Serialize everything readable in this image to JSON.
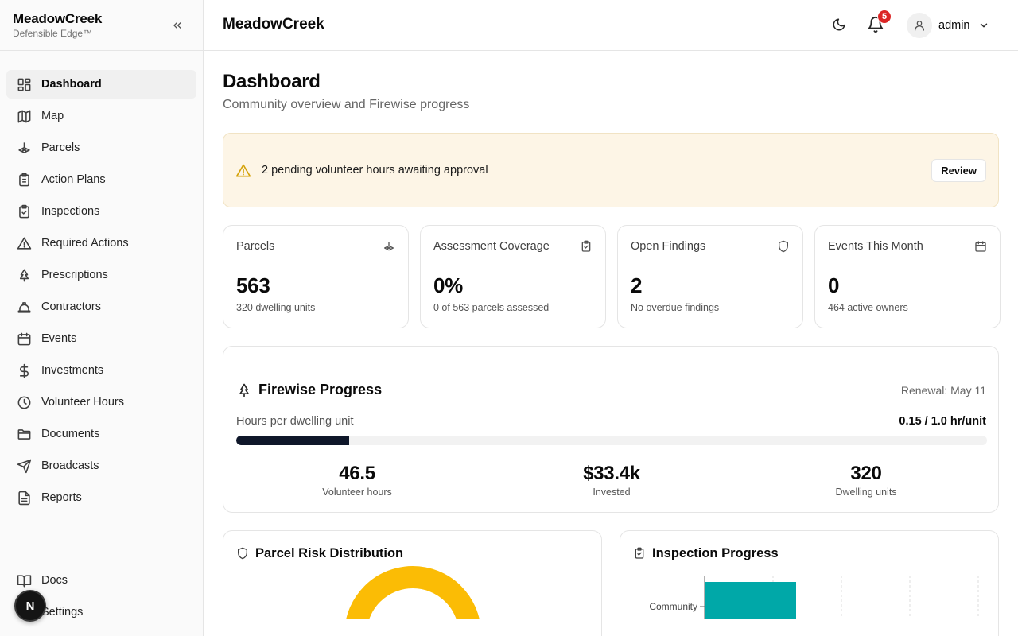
{
  "brand": {
    "name": "MeadowCreek",
    "tagline": "Defensible Edge™"
  },
  "sidebar": {
    "items": [
      {
        "label": "Dashboard",
        "icon": "dashboard-icon",
        "active": true
      },
      {
        "label": "Map",
        "icon": "map-icon"
      },
      {
        "label": "Parcels",
        "icon": "parcels-icon"
      },
      {
        "label": "Action Plans",
        "icon": "clipboard-list-icon"
      },
      {
        "label": "Inspections",
        "icon": "clipboard-check-icon"
      },
      {
        "label": "Required Actions",
        "icon": "warning-icon"
      },
      {
        "label": "Prescriptions",
        "icon": "tree-icon"
      },
      {
        "label": "Contractors",
        "icon": "hard-hat-icon"
      },
      {
        "label": "Events",
        "icon": "calendar-icon"
      },
      {
        "label": "Investments",
        "icon": "dollar-icon"
      },
      {
        "label": "Volunteer Hours",
        "icon": "clock-icon"
      },
      {
        "label": "Documents",
        "icon": "folder-icon"
      },
      {
        "label": "Broadcasts",
        "icon": "send-icon"
      },
      {
        "label": "Reports",
        "icon": "file-text-icon"
      }
    ],
    "footer": [
      {
        "label": "Docs",
        "icon": "book-icon"
      },
      {
        "label": "Settings",
        "icon": "settings-icon"
      }
    ],
    "avatar_letter": "N"
  },
  "topbar": {
    "title": "MeadowCreek",
    "notifications_count": "5",
    "user": "admin"
  },
  "page": {
    "title": "Dashboard",
    "subtitle": "Community overview and Firewise progress"
  },
  "alert": {
    "text": "2 pending volunteer hours awaiting approval",
    "button": "Review"
  },
  "stats": [
    {
      "label": "Parcels",
      "value": "563",
      "sub": "320 dwelling units",
      "icon": "parcels-icon"
    },
    {
      "label": "Assessment Coverage",
      "value": "0%",
      "sub": "0 of 563 parcels assessed",
      "icon": "clipboard-check-icon"
    },
    {
      "label": "Open Findings",
      "value": "2",
      "sub": "No overdue findings",
      "icon": "shield-icon"
    },
    {
      "label": "Events This Month",
      "value": "0",
      "sub": "464 active owners",
      "icon": "calendar-icon"
    }
  ],
  "firewise": {
    "title": "Firewise Progress",
    "renewal": "Renewal: May 11",
    "metric_label": "Hours per dwelling unit",
    "ratio": "0.15 / 1.0 hr/unit",
    "progress": 0.15,
    "kpis": [
      {
        "value": "46.5",
        "label": "Volunteer hours"
      },
      {
        "value": "$33.4k",
        "label": "Invested"
      },
      {
        "value": "320",
        "label": "Dwelling units"
      }
    ]
  },
  "panels": {
    "risk": {
      "title": "Parcel Risk Distribution"
    },
    "inspection": {
      "title": "Inspection Progress",
      "category": "Community"
    }
  },
  "colors": {
    "accent_dark": "#0f172a",
    "alert_bg": "#fdf5e6",
    "warning": "#d4a106",
    "badge": "#dc2626",
    "donut": "#fbbc05",
    "bar": "#00a8a8"
  }
}
